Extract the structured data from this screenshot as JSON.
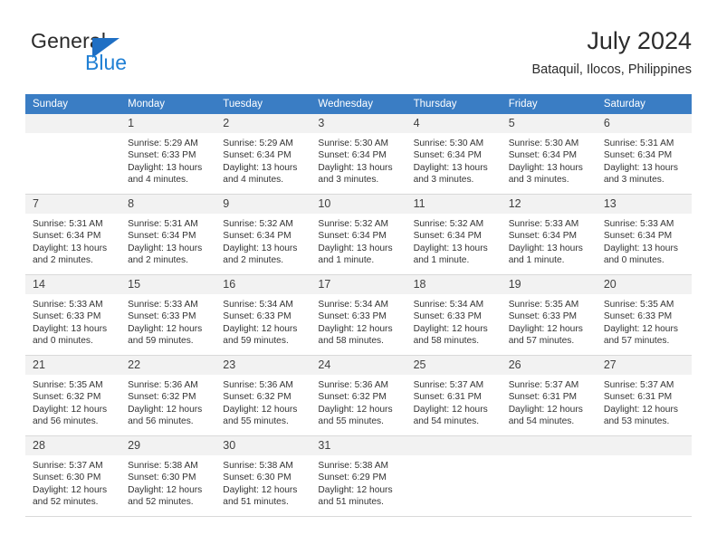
{
  "brand": {
    "name_top": "General",
    "name_bottom": "Blue",
    "triangle_color": "#1f6fc4",
    "blue_color": "#1f7fd4"
  },
  "header": {
    "title": "July 2024",
    "subtitle": "Bataquil, Ilocos, Philippines"
  },
  "theme": {
    "header_row_bg": "#3a7dc4",
    "day_number_bg": "#f2f2f2",
    "grid_line": "#d9d9d9"
  },
  "calendar": {
    "weekday_headers": [
      "Sunday",
      "Monday",
      "Tuesday",
      "Wednesday",
      "Thursday",
      "Friday",
      "Saturday"
    ],
    "labels": {
      "sunrise_prefix": "Sunrise:",
      "sunset_prefix": "Sunset:",
      "daylight_prefix": "Daylight:"
    },
    "weeks": [
      [
        {
          "day": "",
          "sunrise": "",
          "sunset": "",
          "daylight_line1": "",
          "daylight_line2": ""
        },
        {
          "day": "1",
          "sunrise": "Sunrise: 5:29 AM",
          "sunset": "Sunset: 6:33 PM",
          "daylight_line1": "Daylight: 13 hours",
          "daylight_line2": "and 4 minutes."
        },
        {
          "day": "2",
          "sunrise": "Sunrise: 5:29 AM",
          "sunset": "Sunset: 6:34 PM",
          "daylight_line1": "Daylight: 13 hours",
          "daylight_line2": "and 4 minutes."
        },
        {
          "day": "3",
          "sunrise": "Sunrise: 5:30 AM",
          "sunset": "Sunset: 6:34 PM",
          "daylight_line1": "Daylight: 13 hours",
          "daylight_line2": "and 3 minutes."
        },
        {
          "day": "4",
          "sunrise": "Sunrise: 5:30 AM",
          "sunset": "Sunset: 6:34 PM",
          "daylight_line1": "Daylight: 13 hours",
          "daylight_line2": "and 3 minutes."
        },
        {
          "day": "5",
          "sunrise": "Sunrise: 5:30 AM",
          "sunset": "Sunset: 6:34 PM",
          "daylight_line1": "Daylight: 13 hours",
          "daylight_line2": "and 3 minutes."
        },
        {
          "day": "6",
          "sunrise": "Sunrise: 5:31 AM",
          "sunset": "Sunset: 6:34 PM",
          "daylight_line1": "Daylight: 13 hours",
          "daylight_line2": "and 3 minutes."
        }
      ],
      [
        {
          "day": "7",
          "sunrise": "Sunrise: 5:31 AM",
          "sunset": "Sunset: 6:34 PM",
          "daylight_line1": "Daylight: 13 hours",
          "daylight_line2": "and 2 minutes."
        },
        {
          "day": "8",
          "sunrise": "Sunrise: 5:31 AM",
          "sunset": "Sunset: 6:34 PM",
          "daylight_line1": "Daylight: 13 hours",
          "daylight_line2": "and 2 minutes."
        },
        {
          "day": "9",
          "sunrise": "Sunrise: 5:32 AM",
          "sunset": "Sunset: 6:34 PM",
          "daylight_line1": "Daylight: 13 hours",
          "daylight_line2": "and 2 minutes."
        },
        {
          "day": "10",
          "sunrise": "Sunrise: 5:32 AM",
          "sunset": "Sunset: 6:34 PM",
          "daylight_line1": "Daylight: 13 hours",
          "daylight_line2": "and 1 minute."
        },
        {
          "day": "11",
          "sunrise": "Sunrise: 5:32 AM",
          "sunset": "Sunset: 6:34 PM",
          "daylight_line1": "Daylight: 13 hours",
          "daylight_line2": "and 1 minute."
        },
        {
          "day": "12",
          "sunrise": "Sunrise: 5:33 AM",
          "sunset": "Sunset: 6:34 PM",
          "daylight_line1": "Daylight: 13 hours",
          "daylight_line2": "and 1 minute."
        },
        {
          "day": "13",
          "sunrise": "Sunrise: 5:33 AM",
          "sunset": "Sunset: 6:34 PM",
          "daylight_line1": "Daylight: 13 hours",
          "daylight_line2": "and 0 minutes."
        }
      ],
      [
        {
          "day": "14",
          "sunrise": "Sunrise: 5:33 AM",
          "sunset": "Sunset: 6:33 PM",
          "daylight_line1": "Daylight: 13 hours",
          "daylight_line2": "and 0 minutes."
        },
        {
          "day": "15",
          "sunrise": "Sunrise: 5:33 AM",
          "sunset": "Sunset: 6:33 PM",
          "daylight_line1": "Daylight: 12 hours",
          "daylight_line2": "and 59 minutes."
        },
        {
          "day": "16",
          "sunrise": "Sunrise: 5:34 AM",
          "sunset": "Sunset: 6:33 PM",
          "daylight_line1": "Daylight: 12 hours",
          "daylight_line2": "and 59 minutes."
        },
        {
          "day": "17",
          "sunrise": "Sunrise: 5:34 AM",
          "sunset": "Sunset: 6:33 PM",
          "daylight_line1": "Daylight: 12 hours",
          "daylight_line2": "and 58 minutes."
        },
        {
          "day": "18",
          "sunrise": "Sunrise: 5:34 AM",
          "sunset": "Sunset: 6:33 PM",
          "daylight_line1": "Daylight: 12 hours",
          "daylight_line2": "and 58 minutes."
        },
        {
          "day": "19",
          "sunrise": "Sunrise: 5:35 AM",
          "sunset": "Sunset: 6:33 PM",
          "daylight_line1": "Daylight: 12 hours",
          "daylight_line2": "and 57 minutes."
        },
        {
          "day": "20",
          "sunrise": "Sunrise: 5:35 AM",
          "sunset": "Sunset: 6:33 PM",
          "daylight_line1": "Daylight: 12 hours",
          "daylight_line2": "and 57 minutes."
        }
      ],
      [
        {
          "day": "21",
          "sunrise": "Sunrise: 5:35 AM",
          "sunset": "Sunset: 6:32 PM",
          "daylight_line1": "Daylight: 12 hours",
          "daylight_line2": "and 56 minutes."
        },
        {
          "day": "22",
          "sunrise": "Sunrise: 5:36 AM",
          "sunset": "Sunset: 6:32 PM",
          "daylight_line1": "Daylight: 12 hours",
          "daylight_line2": "and 56 minutes."
        },
        {
          "day": "23",
          "sunrise": "Sunrise: 5:36 AM",
          "sunset": "Sunset: 6:32 PM",
          "daylight_line1": "Daylight: 12 hours",
          "daylight_line2": "and 55 minutes."
        },
        {
          "day": "24",
          "sunrise": "Sunrise: 5:36 AM",
          "sunset": "Sunset: 6:32 PM",
          "daylight_line1": "Daylight: 12 hours",
          "daylight_line2": "and 55 minutes."
        },
        {
          "day": "25",
          "sunrise": "Sunrise: 5:37 AM",
          "sunset": "Sunset: 6:31 PM",
          "daylight_line1": "Daylight: 12 hours",
          "daylight_line2": "and 54 minutes."
        },
        {
          "day": "26",
          "sunrise": "Sunrise: 5:37 AM",
          "sunset": "Sunset: 6:31 PM",
          "daylight_line1": "Daylight: 12 hours",
          "daylight_line2": "and 54 minutes."
        },
        {
          "day": "27",
          "sunrise": "Sunrise: 5:37 AM",
          "sunset": "Sunset: 6:31 PM",
          "daylight_line1": "Daylight: 12 hours",
          "daylight_line2": "and 53 minutes."
        }
      ],
      [
        {
          "day": "28",
          "sunrise": "Sunrise: 5:37 AM",
          "sunset": "Sunset: 6:30 PM",
          "daylight_line1": "Daylight: 12 hours",
          "daylight_line2": "and 52 minutes."
        },
        {
          "day": "29",
          "sunrise": "Sunrise: 5:38 AM",
          "sunset": "Sunset: 6:30 PM",
          "daylight_line1": "Daylight: 12 hours",
          "daylight_line2": "and 52 minutes."
        },
        {
          "day": "30",
          "sunrise": "Sunrise: 5:38 AM",
          "sunset": "Sunset: 6:30 PM",
          "daylight_line1": "Daylight: 12 hours",
          "daylight_line2": "and 51 minutes."
        },
        {
          "day": "31",
          "sunrise": "Sunrise: 5:38 AM",
          "sunset": "Sunset: 6:29 PM",
          "daylight_line1": "Daylight: 12 hours",
          "daylight_line2": "and 51 minutes."
        },
        {
          "day": "",
          "sunrise": "",
          "sunset": "",
          "daylight_line1": "",
          "daylight_line2": ""
        },
        {
          "day": "",
          "sunrise": "",
          "sunset": "",
          "daylight_line1": "",
          "daylight_line2": ""
        },
        {
          "day": "",
          "sunrise": "",
          "sunset": "",
          "daylight_line1": "",
          "daylight_line2": ""
        }
      ]
    ]
  }
}
